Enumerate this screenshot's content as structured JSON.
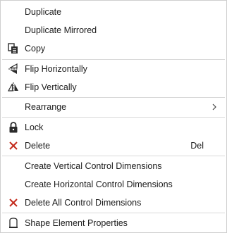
{
  "menu": {
    "items": [
      {
        "label": "Duplicate",
        "icon": ""
      },
      {
        "label": "Duplicate Mirrored",
        "icon": ""
      },
      {
        "label": "Copy",
        "icon": "copy-icon"
      },
      {
        "label": "Flip Horizontally",
        "icon": "flip-horizontal-icon"
      },
      {
        "label": "Flip Vertically",
        "icon": "flip-vertical-icon"
      },
      {
        "label": "Rearrange",
        "icon": "",
        "submenu": true
      },
      {
        "label": "Lock",
        "icon": "lock-icon"
      },
      {
        "label": "Delete",
        "icon": "delete-x-icon",
        "shortcut": "Del"
      },
      {
        "label": "Create Vertical Control Dimensions",
        "icon": ""
      },
      {
        "label": "Create Horizontal Control Dimensions",
        "icon": ""
      },
      {
        "label": "Delete All Control Dimensions",
        "icon": "delete-x-icon"
      },
      {
        "label": "Shape Element Properties",
        "icon": "shape-properties-icon"
      }
    ]
  },
  "colors": {
    "delete_red": "#c42b1c",
    "icon_dark": "#2b2b2b",
    "separator": "#d9d9d9"
  }
}
